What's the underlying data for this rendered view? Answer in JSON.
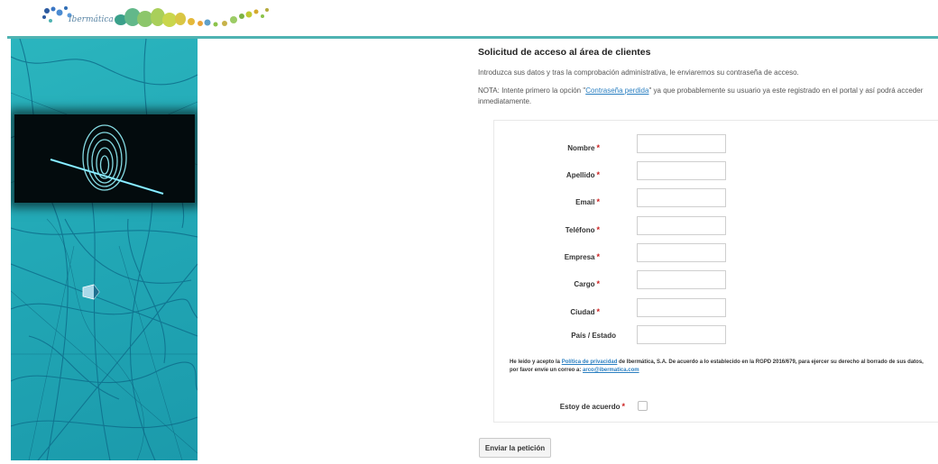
{
  "header": {
    "logo_text": "Ibermática",
    "accent_color": "#4fb3b2"
  },
  "form": {
    "title": "Solicitud de acceso al área de clientes",
    "intro": "Introduzca sus datos y tras la comprobación administrativa, le enviaremos su contraseña de acceso.",
    "note_prefix": "NOTA: Intente primero la opción \"",
    "note_link": "Contraseña perdida",
    "note_suffix": "\" ya que probablemente su usuario ya este registrado en el portal y así podrá acceder inmediatamente.",
    "fields": [
      {
        "label": "Nombre",
        "required": "*",
        "value": ""
      },
      {
        "label": "Apellido",
        "required": "*",
        "value": ""
      },
      {
        "label": "Email",
        "required": "*",
        "value": ""
      },
      {
        "label": "Teléfono",
        "required": "*",
        "value": ""
      },
      {
        "label": "Empresa",
        "required": "*",
        "value": ""
      },
      {
        "label": "Cargo",
        "required": "*",
        "value": ""
      },
      {
        "label": "Ciudad",
        "required": "*",
        "value": ""
      },
      {
        "label": "País / Estado",
        "required": "",
        "value": ""
      }
    ],
    "consent": {
      "text1": "He leído y acepto la ",
      "policy_link": "Política de privacidad",
      "text2": " de Ibermática, S.A. De acuerdo a lo establecido en la RGPD 2016/679, para ejercer su derecho al borrado de sus datos, por favor envíe un correo a: ",
      "email_link": "arco@ibermatica.com"
    },
    "agree_label": "Estoy de acuerdo",
    "agree_required": "*",
    "submit_label": "Enviar la petición"
  }
}
